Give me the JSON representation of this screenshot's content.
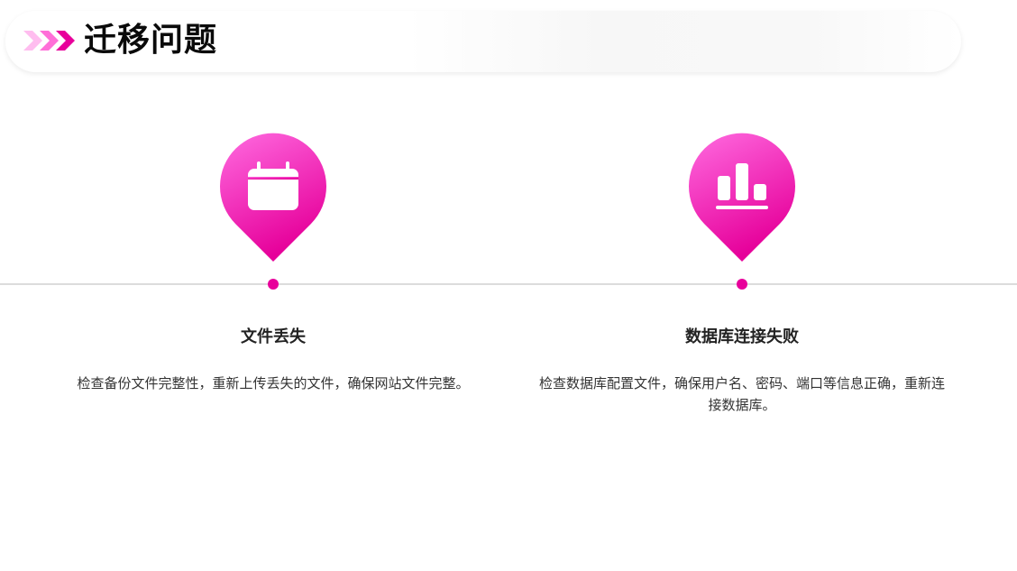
{
  "header": {
    "title": "迁移问题",
    "icon": "triple-chevron-right-icon"
  },
  "colors": {
    "accent": "#e8009b",
    "accent_light": "#ff66dd",
    "line": "#dcdcdc"
  },
  "items": [
    {
      "icon": "calendar-icon",
      "title": "文件丢失",
      "description": "检查备份文件完整性，重新上传丢失的文件，确保网站文件完整。"
    },
    {
      "icon": "bar-chart-icon",
      "title": "数据库连接失败",
      "description": "检查数据库配置文件，确保用户名、密码、端口等信息正确，重新连接数据库。"
    }
  ]
}
